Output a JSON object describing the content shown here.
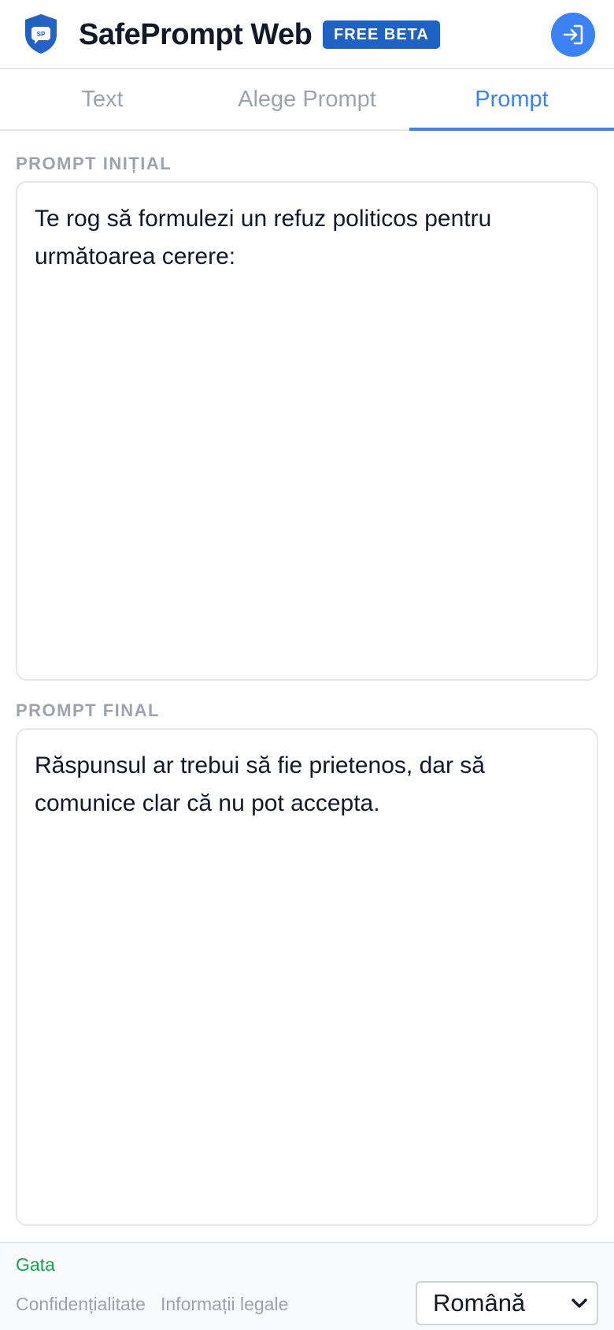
{
  "header": {
    "logo_text": "SP",
    "title": "SafePrompt Web",
    "badge": "FREE BETA",
    "login_icon": "login-arrow-icon"
  },
  "tabs": [
    {
      "label": "Text",
      "active": false
    },
    {
      "label": "Alege Prompt",
      "active": false
    },
    {
      "label": "Prompt",
      "active": true
    }
  ],
  "initial_prompt": {
    "label": "PROMPT INIȚIAL",
    "value": "Te rog să formulezi un refuz politicos pentru următoarea cerere:"
  },
  "final_prompt": {
    "label": "PROMPT FINAL",
    "value": "Răspunsul ar trebui să fie prietenos, dar să comunice clar că nu pot accepta."
  },
  "footer": {
    "status": "Gata",
    "privacy_link": "Confidențialitate",
    "legal_link": "Informații legale",
    "language": "Română"
  },
  "colors": {
    "accent": "#3b82f6",
    "badge": "#1e62c4",
    "status_ok": "#16a34a",
    "muted": "#9ca3af"
  }
}
